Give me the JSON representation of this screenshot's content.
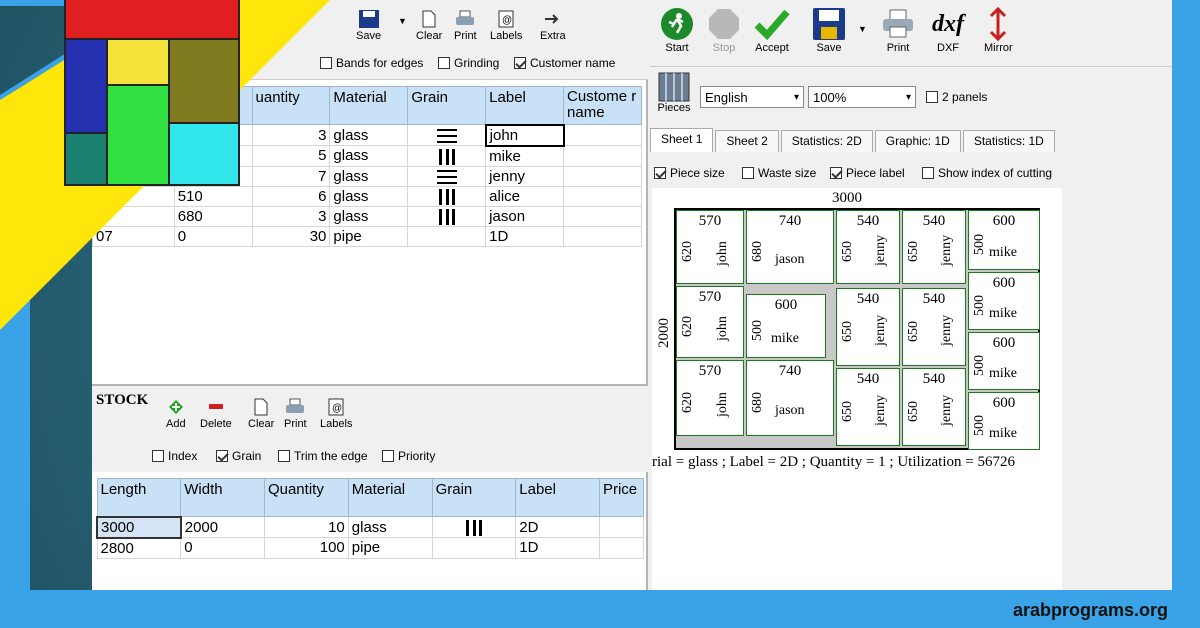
{
  "site": "arabprograms.org",
  "toolbar_left": {
    "save": "Save",
    "clear": "Clear",
    "print": "Print",
    "labels": "Labels",
    "extra": "Extra"
  },
  "options_top": {
    "bands": "Bands for edges",
    "grinding": "Grinding",
    "customer": "Customer name"
  },
  "pieces_table": {
    "headers": [
      "uantity",
      "Material",
      "Grain",
      "Label",
      "Custome r name"
    ],
    "rows": [
      {
        "width": "",
        "qty": "3",
        "material": "glass",
        "grain": "h",
        "label": "john"
      },
      {
        "width": "",
        "qty": "5",
        "material": "glass",
        "grain": "v",
        "label": "mike"
      },
      {
        "width": "",
        "qty": "7",
        "material": "glass",
        "grain": "h",
        "label": "jenny"
      },
      {
        "width": "510",
        "qty": "6",
        "material": "glass",
        "grain": "v",
        "label": "alice"
      },
      {
        "width": "680",
        "qty": "3",
        "material": "glass",
        "grain": "v",
        "label": "jason"
      },
      {
        "width": "0",
        "qty": "30",
        "material": "pipe",
        "grain": "",
        "label": "1D"
      }
    ],
    "row6_len": "07"
  },
  "stock": {
    "title": "STOCK",
    "toolbar": {
      "add": "Add",
      "delete": "Delete",
      "clear": "Clear",
      "print": "Print",
      "labels": "Labels"
    },
    "options": {
      "index": "Index",
      "grain": "Grain",
      "trim": "Trim the edge",
      "priority": "Priority"
    },
    "headers": [
      "Length",
      "Width",
      "Quantity",
      "Material",
      "Grain",
      "Label",
      "Price"
    ],
    "rows": [
      {
        "length": "3000",
        "width": "2000",
        "qty": "10",
        "material": "glass",
        "grain": "v",
        "label": "2D"
      },
      {
        "length": "2800",
        "width": "0",
        "qty": "100",
        "material": "pipe",
        "grain": "",
        "label": "1D"
      }
    ]
  },
  "toolbar_right": {
    "start": "Start",
    "stop": "Stop",
    "accept": "Accept",
    "save": "Save",
    "print": "Print",
    "dxf": "DXF",
    "mirror": "Mirror",
    "dxf_glyph": "dxf"
  },
  "pieces_btn": "Pieces",
  "language": "English",
  "zoom": "100%",
  "two_panels": "2 panels",
  "tabs": [
    "Sheet 1",
    "Sheet 2",
    "Statistics: 2D",
    "Graphic: 1D",
    "Statistics: 1D"
  ],
  "view_options": {
    "piece_size": "Piece size",
    "waste_size": "Waste size",
    "piece_label": "Piece label",
    "show_index": "Show index of cutting"
  },
  "sheet": {
    "width_label": "3000",
    "height_label": "2000",
    "info": "rial = glass ; Label = 2D ; Quantity = 1 ; Utilization = 56726",
    "pieces": [
      {
        "w": "570",
        "h": "620",
        "label": "john"
      },
      {
        "w": "740",
        "h": "680",
        "label": "jason"
      },
      {
        "w": "540",
        "h": "650",
        "label": "jenny"
      },
      {
        "w": "540",
        "h": "650",
        "label": "jenny"
      },
      {
        "w": "600",
        "h": "500",
        "label": "mike"
      },
      {
        "w": "570",
        "h": "620",
        "label": "john"
      },
      {
        "w": "600",
        "h": "500",
        "label": "mike"
      },
      {
        "w": "540",
        "h": "650",
        "label": "jenny"
      },
      {
        "w": "540",
        "h": "650",
        "label": "jenny"
      },
      {
        "w": "600",
        "h": "500",
        "label": "mike"
      },
      {
        "w": "570",
        "h": "620",
        "label": "john"
      },
      {
        "w": "740",
        "h": "680",
        "label": "jason"
      },
      {
        "w": "540",
        "h": "650",
        "label": "jenny"
      },
      {
        "w": "540",
        "h": "650",
        "label": "jenny"
      },
      {
        "w": "600",
        "h": "500",
        "label": "mike"
      },
      {
        "w": "600",
        "h": "500",
        "label": "mike"
      }
    ]
  },
  "colors": {
    "accent_blue": "#3aa2e6",
    "header_blue": "#c9e1f6",
    "piece_border": "#1c7a1c",
    "yellow": "#ffe60a"
  }
}
